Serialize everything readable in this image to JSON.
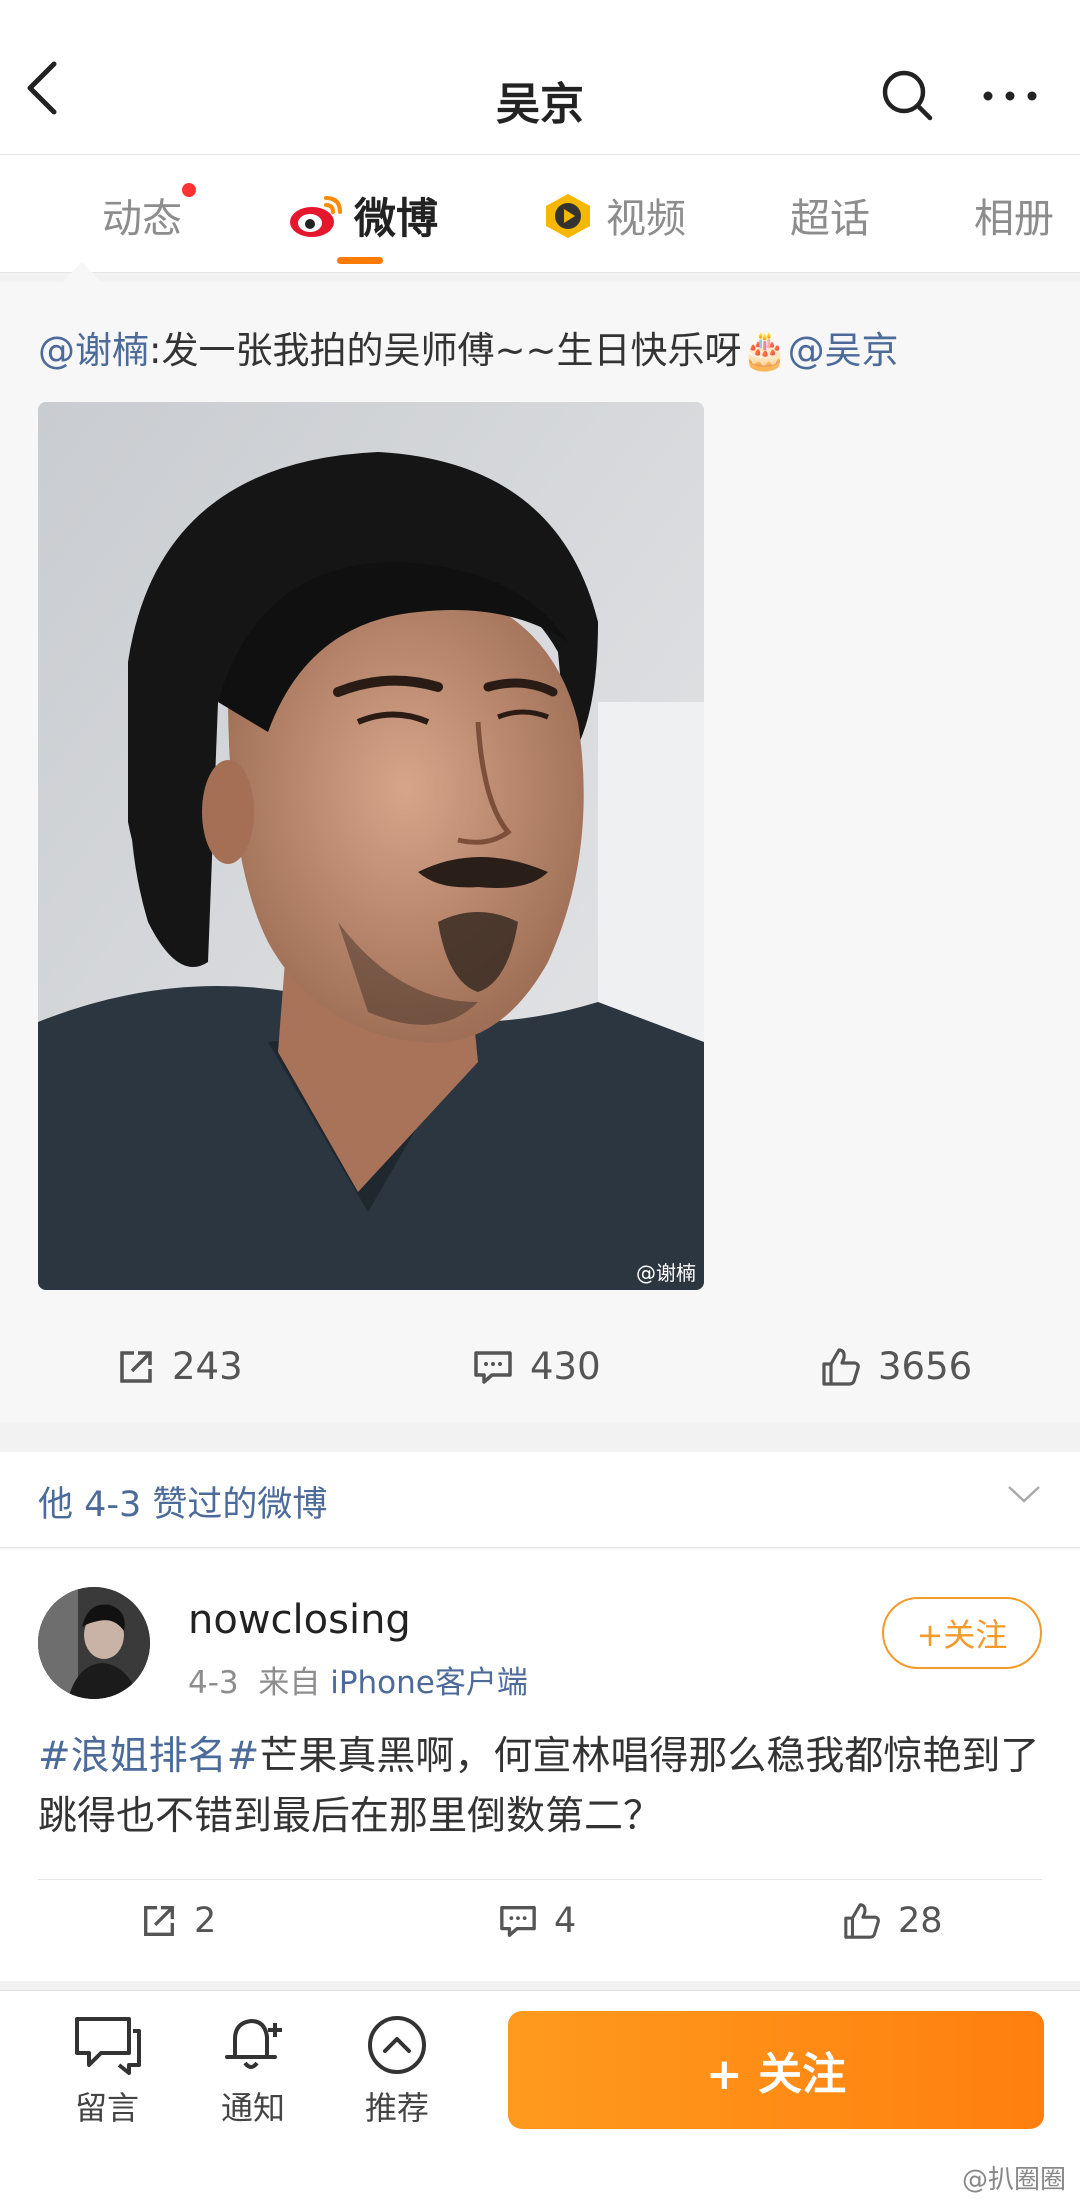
{
  "header": {
    "title": "吴京"
  },
  "tabs": [
    {
      "label": "动态",
      "has_dot": true
    },
    {
      "label": "微博",
      "active": true
    },
    {
      "label": "视频"
    },
    {
      "label": "超话"
    },
    {
      "label": "相册"
    }
  ],
  "repost": {
    "mention_author": "@谢楠",
    "text": ":发一张我拍的吴师傅~~生日快乐呀",
    "emoji": "🎂",
    "mention_target": "@吴京",
    "photo_watermark": "@谢楠",
    "reposts": "243",
    "comments": "430",
    "likes": "3656"
  },
  "liked_section": {
    "label": "他 4-3 赞过的微博"
  },
  "post": {
    "username": "nowclosing",
    "date": "4-3",
    "from_prefix": "来自",
    "source": "iPhone客户端",
    "follow_label": "+关注",
    "hashtag": "#浪姐排名#",
    "text": "芒果真黑啊，何宣林唱得那么稳我都惊艳到了跳得也不错到最后在那里倒数第二？",
    "reposts": "2",
    "comments": "4",
    "likes": "28"
  },
  "bottom_bar": {
    "message_label": "留言",
    "notify_label": "通知",
    "recommend_label": "推荐",
    "follow_label": "+ 关注"
  },
  "corner_watermark": "@扒圈圈",
  "colors": {
    "accent": "#ff7f0e",
    "link": "#4c6b9a",
    "dot": "#ff3333"
  }
}
